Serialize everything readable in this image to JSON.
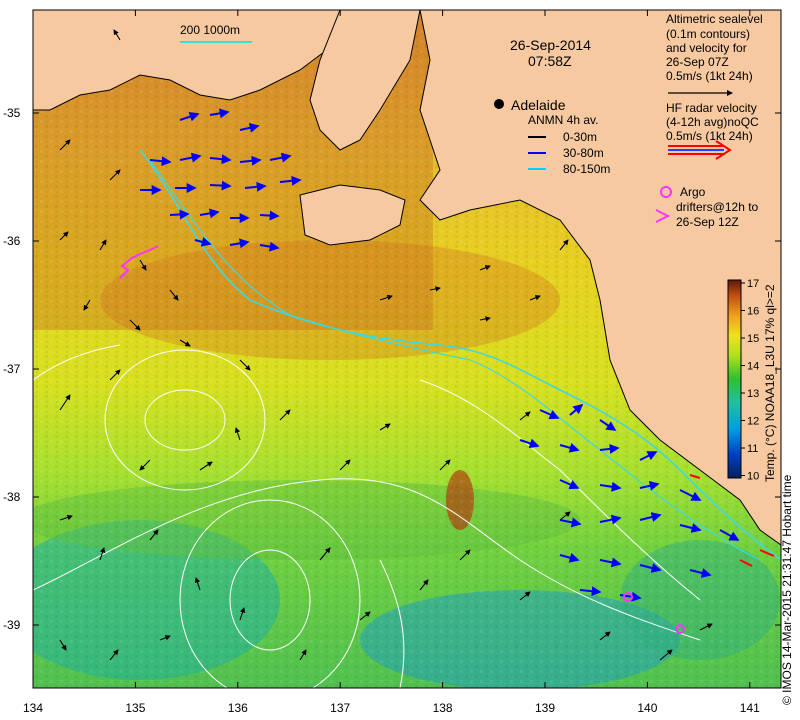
{
  "map": {
    "date": "26-Sep-2014",
    "time": "07:58Z",
    "scale_bar": {
      "label": "200  1000m"
    },
    "place_label": "Adelaide",
    "x_ticks": [
      "134",
      "135",
      "136",
      "137",
      "138",
      "139",
      "140",
      "141"
    ],
    "y_ticks": [
      "-35",
      "-36",
      "-37",
      "-38",
      "-39"
    ]
  },
  "legend": {
    "altimetric": {
      "lines": [
        "Altimetric sealevel",
        "(0.1m contours)",
        "and velocity for",
        "26-Sep 07Z",
        "0.5m/s (1kt 24h)"
      ]
    },
    "hf_radar": {
      "lines": [
        "HF radar velocity",
        "(4-12h avg)noQC",
        "0.5m/s (1kt 24h)"
      ]
    },
    "anmn": {
      "title": "ANMN 4h av.",
      "items": [
        {
          "label": "0-30m",
          "color": "#000000"
        },
        {
          "label": "30-80m",
          "color": "#0000ff"
        },
        {
          "label": "80-150m",
          "color": "#00d0ff"
        }
      ]
    },
    "argo": {
      "lines": [
        "Argo",
        "drifters@12h to",
        "26-Sep 12Z"
      ],
      "color": "#ff33ff"
    }
  },
  "colorbar": {
    "ticks": [
      "17",
      "16",
      "15",
      "14",
      "13",
      "12",
      "11",
      "10"
    ],
    "label": "Temp. (°C) NOAA18_L3U 17% ql>=2",
    "colors": [
      "#003070",
      "#0050d0",
      "#00a0e0",
      "#20c0b0",
      "#30c040",
      "#a0e020",
      "#f0e020",
      "#f09020",
      "#c05010",
      "#702000"
    ]
  },
  "credit": "© IMOS 14-Mar-2015 21:31:47 Hobart time",
  "colors": {
    "land": "#f7c9a0",
    "sst_warm": "#e07a20",
    "sst_mid": "#e8e020",
    "sst_cool": "#40c040",
    "sst_cold": "#20a0c0",
    "shelf_contour": "#40d8e0",
    "altimetry_contour": "#ffffff",
    "hf_radar": "#ff0000"
  }
}
